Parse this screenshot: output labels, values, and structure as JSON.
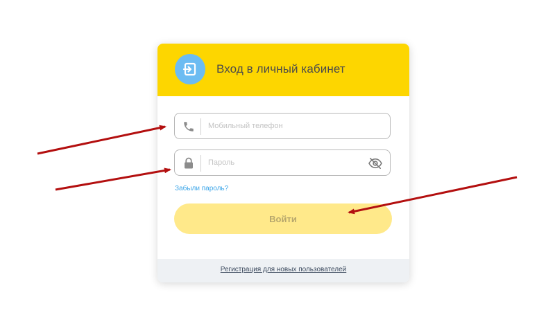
{
  "login": {
    "title": "Вход в личный кабинет",
    "phone_placeholder": "Мобильный телефон",
    "password_placeholder": "Пароль",
    "forgot_label": "Забыли пароль?",
    "submit_label": "Войти",
    "register_label": "Регистрация для новых пользователей"
  },
  "icons": {
    "header": "login-icon",
    "phone": "phone-icon",
    "password": "lock-icon",
    "visibility": "eye-off-icon"
  },
  "colors": {
    "header_bg": "#fdd600",
    "icon_circle": "#6cbcf2",
    "button_bg": "#ffe98a",
    "link": "#3ba5e8",
    "annotation_arrow": "#b30f0f"
  }
}
